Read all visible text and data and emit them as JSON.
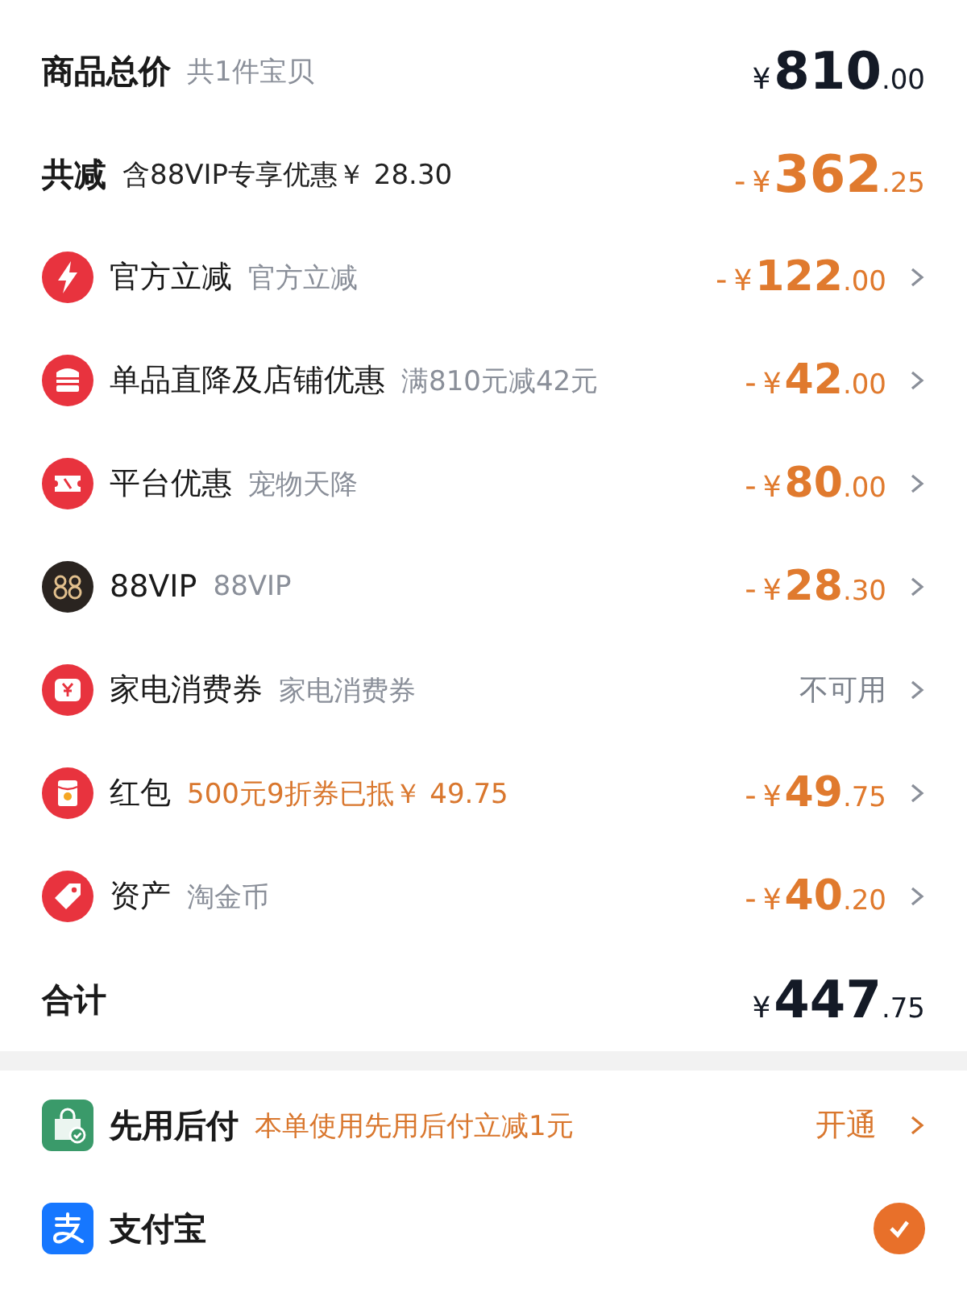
{
  "summary": {
    "label": "商品总价",
    "note": "共1件宝贝",
    "price": {
      "currency": "¥",
      "integer": "810",
      "decimal": ".00"
    }
  },
  "discount_total": {
    "label": "共减",
    "note": "含88VIP专享优惠￥ 28.30",
    "price": {
      "sign": "-",
      "currency": "¥",
      "integer": "362",
      "decimal": ".25"
    }
  },
  "discounts": [
    {
      "title": "官方立减",
      "note": "官方立减",
      "highlighted": false,
      "kind": "amount",
      "price": {
        "sign": "-",
        "currency": "¥",
        "integer": "122",
        "decimal": ".00"
      }
    },
    {
      "title": "单品直降及店铺优惠",
      "note": "满810元减42元",
      "highlighted": false,
      "kind": "amount",
      "price": {
        "sign": "-",
        "currency": "¥",
        "integer": "42",
        "decimal": ".00"
      }
    },
    {
      "title": "平台优惠",
      "note": "宠物天降",
      "highlighted": false,
      "kind": "amount",
      "price": {
        "sign": "-",
        "currency": "¥",
        "integer": "80",
        "decimal": ".00"
      }
    },
    {
      "title": "88VIP",
      "note": "88VIP",
      "highlighted": false,
      "kind": "amount",
      "price": {
        "sign": "-",
        "currency": "¥",
        "integer": "28",
        "decimal": ".30"
      }
    },
    {
      "title": "家电消费券",
      "note": "家电消费券",
      "highlighted": false,
      "kind": "status",
      "status": "不可用"
    },
    {
      "title": "红包",
      "note": "500元9折券已抵￥ 49.75",
      "highlighted": true,
      "kind": "amount",
      "price": {
        "sign": "-",
        "currency": "¥",
        "integer": "49",
        "decimal": ".75"
      }
    },
    {
      "title": "资产",
      "note": "淘金币",
      "highlighted": false,
      "kind": "amount",
      "price": {
        "sign": "-",
        "currency": "¥",
        "integer": "40",
        "decimal": ".20"
      }
    }
  ],
  "total": {
    "label": "合计",
    "price": {
      "currency": "¥",
      "integer": "447",
      "decimal": ".75"
    }
  },
  "payment_methods": [
    {
      "name": "先用后付",
      "kind": "action",
      "promo": "本单使用先用后付立减1元",
      "action": "开通"
    },
    {
      "name": "支付宝",
      "kind": "radio",
      "selected": true
    }
  ]
}
